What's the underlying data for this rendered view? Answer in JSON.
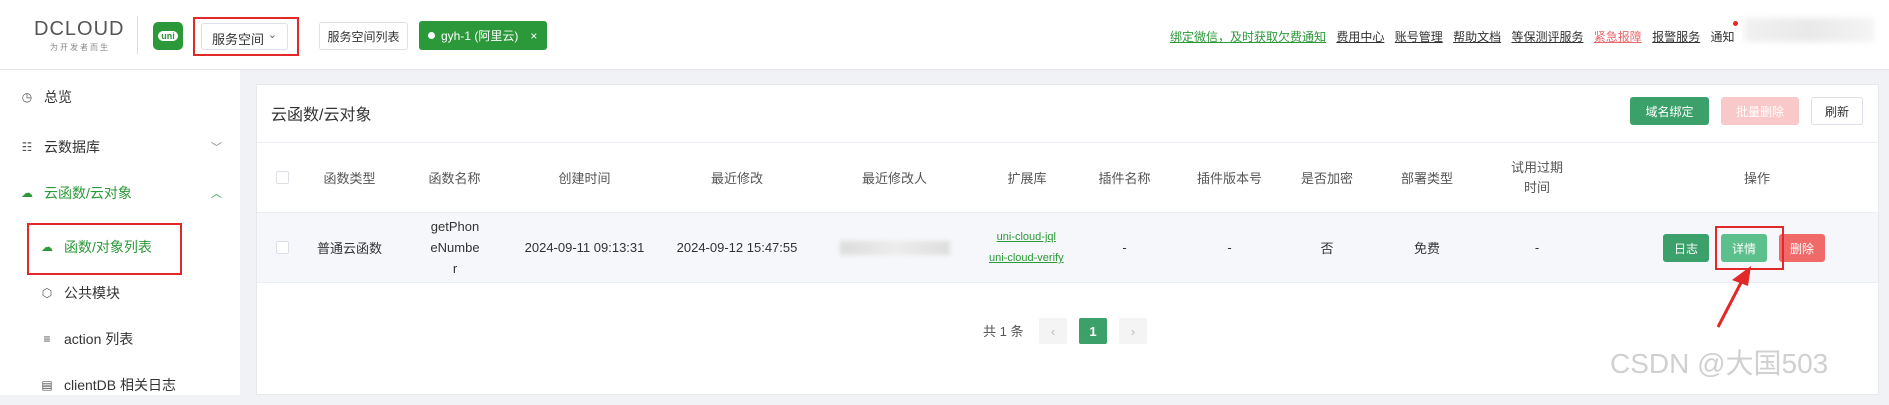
{
  "header": {
    "logo_text": "DCLOUD",
    "logo_subtitle": "为开发者而生",
    "uni_badge": "uni",
    "space_select": "服务空间",
    "space_list_button": "服务空间列表",
    "current_space_tag": "gyh-1 (阿里云)",
    "tag_close": "×",
    "links": {
      "bind_wechat": "绑定微信，及时获取欠费通知",
      "billing": "费用中心",
      "account": "账号管理",
      "help": "帮助文档",
      "security_eval": "等保测评服务",
      "emergency": "紧急报障",
      "report_service": "报警服务",
      "notifications": "通知"
    }
  },
  "sidebar": {
    "items": [
      {
        "label": "总览",
        "icon": "clock-icon"
      },
      {
        "label": "云数据库",
        "icon": "list-icon"
      },
      {
        "label": "云函数/云对象",
        "icon": "cloud-icon"
      }
    ],
    "sub_items": [
      {
        "label": "函数/对象列表",
        "icon": "cloud-icon"
      },
      {
        "label": "公共模块",
        "icon": "cube-icon"
      },
      {
        "label": "action 列表",
        "icon": "lines-icon"
      },
      {
        "label": "clientDB 相关日志",
        "icon": "doc-icon"
      }
    ]
  },
  "main": {
    "title": "云函数/云对象",
    "buttons": {
      "bind_domain": "域名绑定",
      "batch_delete": "批量删除",
      "refresh": "刷新"
    },
    "table": {
      "headers": [
        "函数类型",
        "函数名称",
        "创建时间",
        "最近修改",
        "最近修改人",
        "扩展库",
        "插件名称",
        "插件版本号",
        "是否加密",
        "部署类型",
        "试用过期时间",
        "操作"
      ],
      "rows": [
        {
          "type": "普通云函数",
          "name": "getPhoneNumber",
          "created": "2024-09-11 09:13:31",
          "modified": "2024-09-12 15:47:55",
          "ext_libs": [
            "uni-cloud-jql",
            "uni-cloud-verify"
          ],
          "plugin_name": "-",
          "plugin_version": "-",
          "encrypted": "否",
          "deploy_type": "免费",
          "trial_expiry": "-",
          "actions": {
            "log": "日志",
            "detail": "详情",
            "delete": "删除"
          }
        }
      ]
    },
    "pagination": {
      "total": "共 1 条",
      "current_page": "1",
      "prev": "‹",
      "next": "›"
    }
  },
  "watermark": "CSDN @大国503",
  "colors": {
    "brand_green": "#2b9939",
    "button_green": "#3ba06a",
    "annotation_red": "#e22828"
  }
}
